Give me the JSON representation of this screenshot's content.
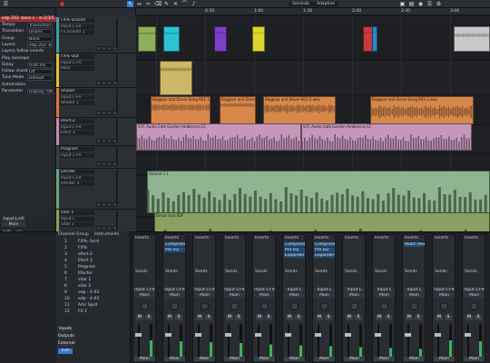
{
  "toolbar": {
    "time_format": "Seconds",
    "snap": "Adaptive",
    "tools": [
      "pointer-tool",
      "range-tool",
      "split-tool",
      "eraser-tool",
      "paint-tool",
      "mute-tool",
      "bend-tool",
      "listen-tool"
    ]
  },
  "ruler": {
    "marks": [
      "0:30",
      "1:00",
      "1:30",
      "2:00",
      "2:30",
      "3:00",
      "3:30"
    ]
  },
  "inspector": {
    "header": "edp-203 -bass-s - in:2/3/5",
    "rows": [
      {
        "label": "Tempo",
        "value": "Transistion"
      },
      {
        "label": "Transistion",
        "value": "Drums"
      },
      {
        "label": "Group",
        "value": "None"
      },
      {
        "label": "Layers",
        "value": "edp-203 -b"
      },
      {
        "label": "Layers follow events",
        "value": ""
      },
      {
        "label": "Play overlaps",
        "value": ""
      },
      {
        "label": "Delay",
        "value": "0.00 ms"
      },
      {
        "label": "Follow chords",
        "value": "Off"
      },
      {
        "label": "Tune Mode",
        "value": "Default"
      },
      {
        "label": "Automation",
        "value": ""
      },
      {
        "label": "Parameter",
        "value": "Display: Off"
      }
    ]
  },
  "tracks": [
    {
      "name": "FX%-Scared",
      "input": "Input L+R",
      "output": "Fx Scared 1",
      "color": "#35a4a4"
    },
    {
      "name": "FX%-Out",
      "input": "Input L+R",
      "output": "Main",
      "color": "#e3c22e"
    },
    {
      "name": "Shaker",
      "input": "Input L+R",
      "output": "Shaker 1",
      "color": "#d87a3a"
    },
    {
      "name": "efect-2",
      "input": "Input L+R",
      "output": "Efect 2",
      "color": "#c88ab8"
    },
    {
      "name": "Program",
      "input": "Input L+R",
      "output": "Program",
      "color": "#3d3f45"
    },
    {
      "name": "Efecter",
      "input": "Input L+R",
      "output": "Efecter 3",
      "color": "#6aa678"
    },
    {
      "name": "sitar 1",
      "input": "Input L",
      "output": "Sitar 1",
      "color": "#8aa05a"
    }
  ],
  "clips": [
    {
      "lane": 0,
      "label": "",
      "color": "#8fae5b"
    },
    {
      "lane": 0,
      "label": "",
      "color": "#2fc2d6"
    },
    {
      "lane": 0,
      "label": "",
      "color": "#7d3fc4"
    },
    {
      "lane": 0,
      "label": "",
      "color": "#dcd62c"
    },
    {
      "lane": 0,
      "label": "",
      "color": "#c83a3a"
    },
    {
      "lane": 0,
      "label": "",
      "color": "#2a86c8"
    },
    {
      "lane": 0,
      "label": "",
      "color": "#c8c8c8"
    },
    {
      "lane": 1,
      "label": "",
      "color": "#cdb766"
    },
    {
      "lane": 2,
      "label": "Bagpipe and Drone Song 601-1.wav",
      "color": "#d8874a"
    },
    {
      "lane": 2,
      "label": "Bagpipe and Drone",
      "color": "#d8874a"
    },
    {
      "lane": 2,
      "label": "Bagpipe and Drone 601-2.wav",
      "color": "#d8874a"
    },
    {
      "lane": 2,
      "label": "Bagpipe and Drone Song 601-2.wav",
      "color": "#d8874a"
    },
    {
      "lane": 3,
      "label": "S7C Audio Cafe Garden Ambience.C2",
      "color": "#c796bb"
    },
    {
      "lane": 3,
      "label": "S7C Audio Cafe Garden Ambience.C2",
      "color": "#c796bb"
    },
    {
      "lane": 5,
      "label": "Ostinat 1.1",
      "color": "#8fb48f"
    },
    {
      "lane": 6,
      "label": "Desat stan B2F",
      "color": "#8a9f62"
    }
  ],
  "mixer": {
    "nav": [
      "Inputs",
      "Outputs",
      "External",
      "Inst"
    ],
    "channel_header": [
      "Channel",
      "Group",
      "Instruments"
    ],
    "list": [
      {
        "num": "1",
        "name": "FX%- Scrd"
      },
      {
        "num": "2",
        "name": "FX%"
      },
      {
        "num": "3",
        "name": "efect-2"
      },
      {
        "num": "4",
        "name": "Efect 3"
      },
      {
        "num": "5",
        "name": "Program"
      },
      {
        "num": "6",
        "name": "Efecter"
      },
      {
        "num": "7",
        "name": "sitar 1"
      },
      {
        "num": "8",
        "name": "sitar 2"
      },
      {
        "num": "9",
        "name": "edp - A 03"
      },
      {
        "num": "10",
        "name": "edp - A 03"
      },
      {
        "num": "11",
        "name": "Amr Sprd"
      },
      {
        "num": "12",
        "name": "FX 1"
      }
    ],
    "strips": [
      {
        "name": "Main",
        "input": "Input L+R",
        "inserts": []
      },
      {
        "name": "Main",
        "input": "Input L+R",
        "inserts": [
          "Compressor",
          "Pro EQ"
        ]
      },
      {
        "name": "Main",
        "input": "Input L+R",
        "inserts": []
      },
      {
        "name": "Main",
        "input": "Input L+R",
        "inserts": []
      },
      {
        "name": "Main",
        "input": "Input L+R",
        "inserts": []
      },
      {
        "name": "Main",
        "input": "Input L",
        "inserts": [
          "Compressor",
          "Pro EQ",
          "Expander"
        ]
      },
      {
        "name": "Main",
        "input": "Input L",
        "inserts": [
          "Compressor",
          "Pro EQ",
          "Expander"
        ]
      },
      {
        "name": "Main",
        "input": "Input L",
        "inserts": []
      },
      {
        "name": "Main",
        "input": "Input L",
        "inserts": []
      },
      {
        "name": "Main",
        "input": "Input L",
        "inserts": [
          "Room Reverb"
        ]
      },
      {
        "name": "Main",
        "input": "Input L+R",
        "inserts": []
      },
      {
        "name": "Main",
        "input": "Input L+R",
        "inserts": []
      }
    ],
    "strip_labels": {
      "inserts": "Inserts",
      "sends": "Sends",
      "mute": "M",
      "solo": "S"
    }
  },
  "left_mixer": {
    "title": "Input L+R",
    "sub": "Main",
    "values": [
      "0dB",
      "<C>"
    ],
    "footer_title": "edp-203 -bass-s -in:2/3",
    "event_rows": [
      {
        "label": "Event FX",
        "value": "0 bits"
      },
      {
        "label": "Start",
        "value": "00:00:00.001"
      },
      {
        "label": "End",
        "value": "00:03:25.200"
      },
      {
        "label": "File Tempo",
        "value": "120"
      }
    ]
  }
}
